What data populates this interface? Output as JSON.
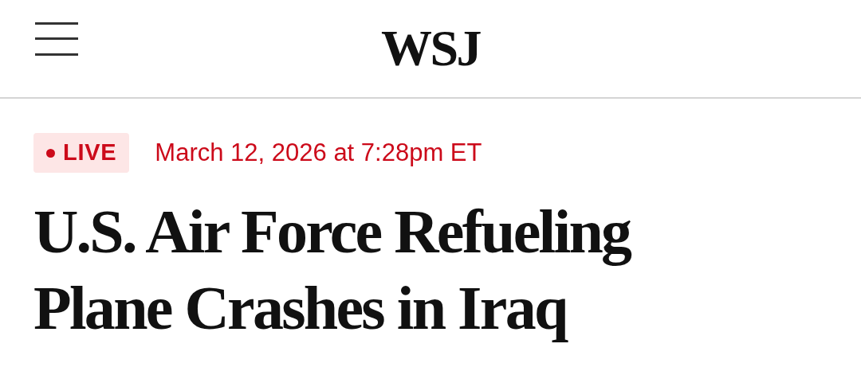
{
  "header": {
    "logo": "WSJ"
  },
  "article": {
    "badge": {
      "label": "LIVE",
      "live": true
    },
    "timestamp": "March 12, 2026 at 7:28pm ET",
    "headline": "U.S. Air Force Refueling Plane Crashes in Iraq"
  }
}
